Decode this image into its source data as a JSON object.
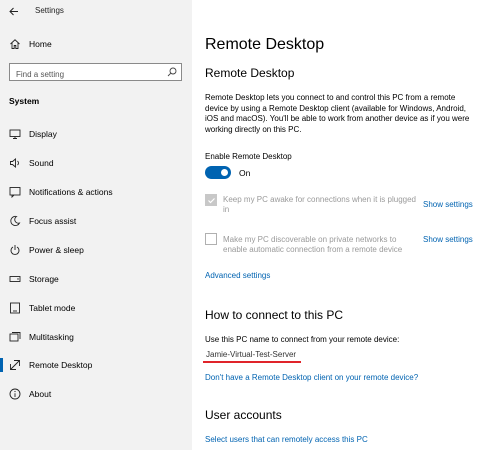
{
  "app": {
    "title": "Settings"
  },
  "sidebar": {
    "home_label": "Home",
    "search_placeholder": "Find a setting",
    "section_label": "System",
    "items": [
      {
        "label": "Display",
        "icon": "display-icon"
      },
      {
        "label": "Sound",
        "icon": "sound-icon"
      },
      {
        "label": "Notifications & actions",
        "icon": "notifications-icon"
      },
      {
        "label": "Focus assist",
        "icon": "focus-assist-icon"
      },
      {
        "label": "Power & sleep",
        "icon": "power-icon"
      },
      {
        "label": "Storage",
        "icon": "storage-icon"
      },
      {
        "label": "Tablet mode",
        "icon": "tablet-icon"
      },
      {
        "label": "Multitasking",
        "icon": "multitasking-icon"
      },
      {
        "label": "Remote Desktop",
        "icon": "remote-desktop-icon",
        "selected": true
      },
      {
        "label": "About",
        "icon": "about-icon"
      }
    ],
    "accent_color": "#0063b1"
  },
  "main": {
    "page_title": "Remote Desktop",
    "section1_title": "Remote Desktop",
    "description": "Remote Desktop lets you connect to and control this PC from a remote device by using a Remote Desktop client (available for Windows, Android, iOS and macOS). You'll be able to work from another device as if you were working directly on this PC.",
    "enable_label": "Enable Remote Desktop",
    "toggle_state": "On",
    "toggle_on": true,
    "option1": {
      "text": "Keep my PC awake for connections when it is plugged in",
      "checked": true,
      "link": "Show settings"
    },
    "option2": {
      "text": "Make my PC discoverable on private networks to enable automatic connection from a remote device",
      "checked": false,
      "link": "Show settings"
    },
    "advanced_link": "Advanced settings",
    "section2_title": "How to connect to this PC",
    "connect_instruction": "Use this PC name to connect from your remote device:",
    "pc_name": "Jamie-Virtual-Test-Server",
    "client_link": "Don't have a Remote Desktop client on your remote device?",
    "section3_title": "User accounts",
    "users_link": "Select users that can remotely access this PC"
  }
}
